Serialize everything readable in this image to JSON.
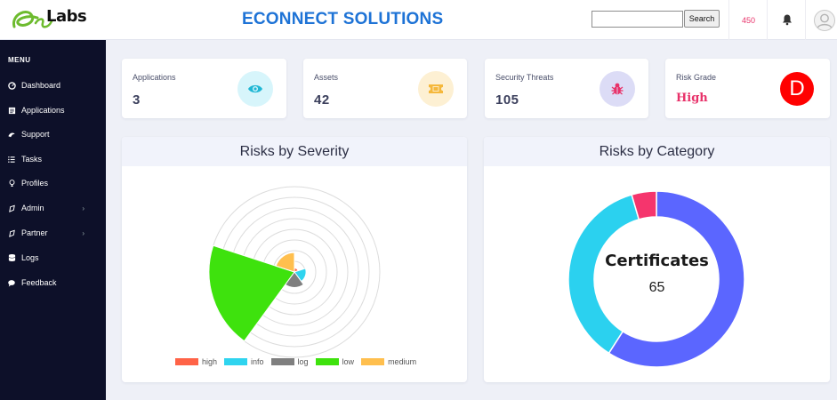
{
  "header": {
    "logo_text": "Labs",
    "app_title": "ECONNECT SOLUTIONS",
    "search": {
      "placeholder": "",
      "button_label": "Search"
    },
    "notification_count": "450",
    "icons": [
      "bell-icon",
      "user-avatar-icon"
    ]
  },
  "sidebar": {
    "menu_title": "MENU",
    "items": [
      {
        "label": "Dashboard",
        "icon": "dashboard-icon"
      },
      {
        "label": "Applications",
        "icon": "applications-icon"
      },
      {
        "label": "Support",
        "icon": "support-icon"
      },
      {
        "label": "Tasks",
        "icon": "tasks-icon"
      },
      {
        "label": "Profiles",
        "icon": "profiles-icon"
      },
      {
        "label": "Admin",
        "icon": "admin-icon",
        "has_submenu": true
      },
      {
        "label": "Partner",
        "icon": "partner-icon",
        "has_submenu": true
      },
      {
        "label": "Logs",
        "icon": "logs-icon"
      },
      {
        "label": "Feedback",
        "icon": "feedback-icon"
      }
    ]
  },
  "stats": [
    {
      "label": "Applications",
      "value": "3",
      "icon": "eye-icon",
      "icon_bg": "#d7f5fb",
      "icon_color": "#1fb7d4"
    },
    {
      "label": "Assets",
      "value": "42",
      "icon": "ticket-icon",
      "icon_bg": "#fdf0d3",
      "icon_color": "#f5b83c"
    },
    {
      "label": "Security Threats",
      "value": "105",
      "icon": "bug-icon",
      "icon_bg": "#dcdcf6",
      "icon_color": "#e8326a"
    },
    {
      "label": "Risk Grade",
      "value": "High",
      "grade": "D",
      "grade_color": "#ff0000"
    }
  ],
  "severity_panel": {
    "title": "Risks by Severity",
    "chart_data": {
      "type": "polar-area",
      "categories": [
        "high",
        "info",
        "log",
        "low",
        "medium"
      ],
      "values": [
        1,
        3,
        4,
        22,
        5
      ],
      "colors": [
        "#ff6347",
        "#2fd4ef",
        "#7f7f7f",
        "#3ee20d",
        "#ffbf4e"
      ],
      "legend_position": "bottom"
    }
  },
  "category_panel": {
    "title": "Risks by Category",
    "center_label": "Certificates",
    "center_value": "65",
    "chart_data": {
      "type": "doughnut",
      "segments": [
        {
          "value": 65,
          "color": "#5b66ff"
        },
        {
          "value": 40,
          "color": "#2bd1ef"
        },
        {
          "value": 5,
          "color": "#f5356d"
        }
      ]
    }
  }
}
